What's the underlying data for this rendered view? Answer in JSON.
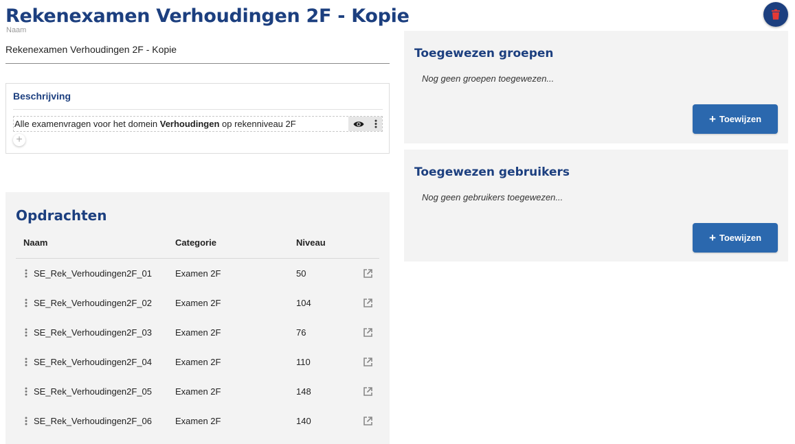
{
  "page": {
    "title": "Rekenexamen Verhoudingen 2F - Kopie",
    "delete_icon": "trash-icon"
  },
  "name_field": {
    "label": "Naam",
    "value": "Rekenexamen Verhoudingen 2F - Kopie"
  },
  "description": {
    "title": "Beschrijving",
    "text_before": "Alle examenvragen voor het domein ",
    "text_bold": "Verhoudingen",
    "text_after": " op rekenniveau 2F",
    "tool_icons": [
      "eye-icon",
      "more-vertical-icon"
    ],
    "add_icon": "plus-icon"
  },
  "assigned_groups": {
    "title": "Toegewezen groepen",
    "empty_text": "Nog geen groepen toegewezen...",
    "button_label": "Toewijzen"
  },
  "assigned_users": {
    "title": "Toegewezen gebruikers",
    "empty_text": "Nog geen gebruikers toegewezen...",
    "button_label": "Toewijzen"
  },
  "tasks": {
    "title": "Opdrachten",
    "columns": {
      "name": "Naam",
      "category": "Categorie",
      "level": "Niveau"
    },
    "rows": [
      {
        "name": "SE_Rek_Verhoudingen2F_01",
        "category": "Examen 2F",
        "level": "50"
      },
      {
        "name": "SE_Rek_Verhoudingen2F_02",
        "category": "Examen 2F",
        "level": "104"
      },
      {
        "name": "SE_Rek_Verhoudingen2F_03",
        "category": "Examen 2F",
        "level": "76"
      },
      {
        "name": "SE_Rek_Verhoudingen2F_04",
        "category": "Examen 2F",
        "level": "110"
      },
      {
        "name": "SE_Rek_Verhoudingen2F_05",
        "category": "Examen 2F",
        "level": "148"
      },
      {
        "name": "SE_Rek_Verhoudingen2F_06",
        "category": "Examen 2F",
        "level": "140"
      }
    ]
  },
  "colors": {
    "primary": "#1c3f7f",
    "button": "#2b68ae",
    "danger": "#e53935",
    "panel_bg": "#f3f3f3"
  }
}
